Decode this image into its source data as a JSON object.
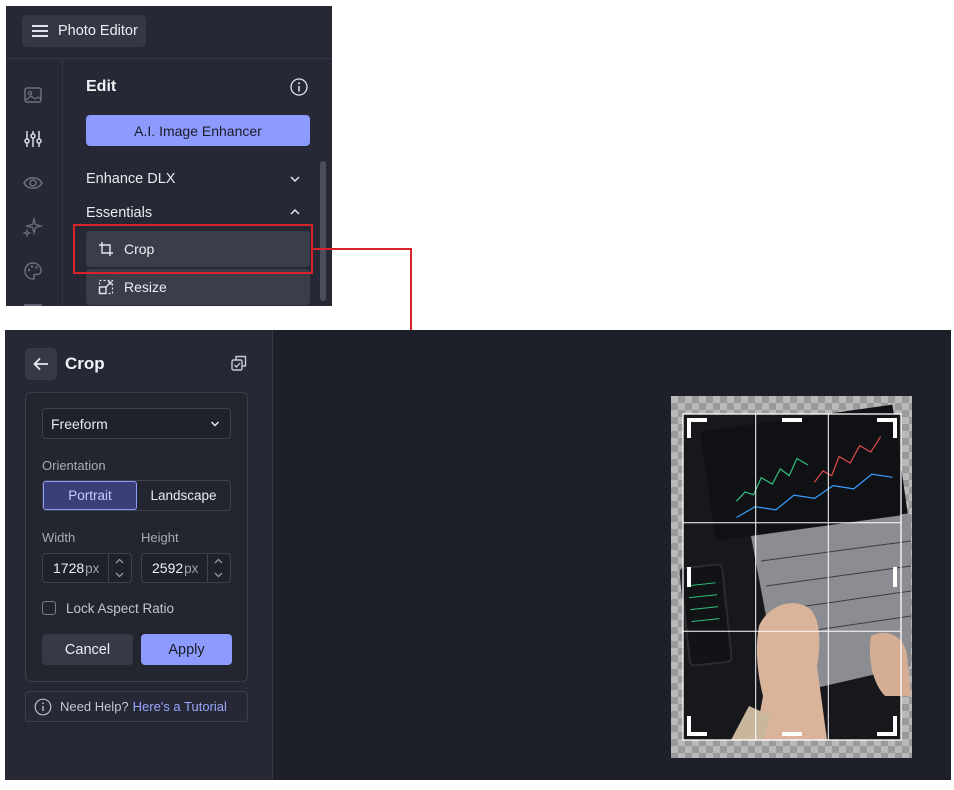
{
  "top": {
    "menu_label": "Photo Editor",
    "edit_title": "Edit",
    "ai_button": "A.I. Image Enhancer",
    "sections": [
      {
        "label": "Enhance DLX",
        "state": "collapsed"
      },
      {
        "label": "Essentials",
        "state": "expanded"
      }
    ],
    "tools": [
      {
        "label": "Crop",
        "icon": "crop-icon"
      },
      {
        "label": "Resize",
        "icon": "resize-icon"
      }
    ],
    "rail_icons": [
      "image-icon",
      "sliders-icon",
      "eye-icon",
      "sparkle-icon",
      "palette-icon",
      "frame-icon"
    ]
  },
  "crop_panel": {
    "title": "Crop",
    "aspect_select": "Freeform",
    "orientation_label": "Orientation",
    "orientation_options": [
      "Portrait",
      "Landscape"
    ],
    "orientation_selected": "Portrait",
    "width_label": "Width",
    "height_label": "Height",
    "width_value": "1728",
    "height_value": "2592",
    "unit": "px",
    "lock_label": "Lock Aspect Ratio",
    "lock_checked": false,
    "cancel_label": "Cancel",
    "apply_label": "Apply",
    "help_text": "Need Help?",
    "help_link": "Here's a Tutorial"
  },
  "colors": {
    "accent": "#8d9bff",
    "panel": "#262935",
    "canvas": "#1d1f29",
    "callout": "#d9232b"
  }
}
